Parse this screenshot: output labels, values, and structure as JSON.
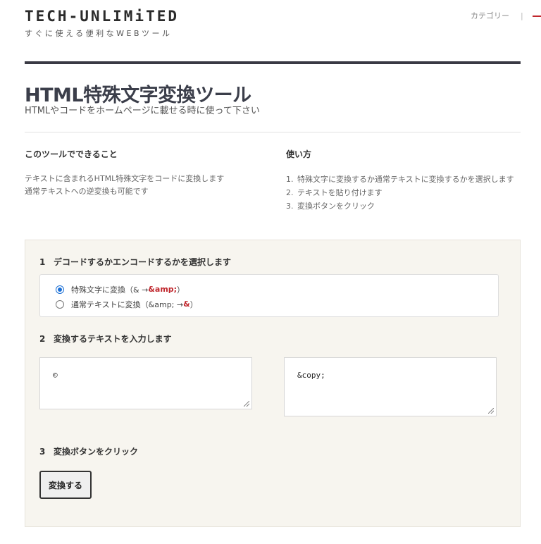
{
  "site": {
    "logo": "TECH-UNLIMiTED",
    "tagline": "すぐに使える便利なWEBツール",
    "nav_categories": "カテゴリー",
    "nav_separator": "|"
  },
  "page": {
    "title": "HTML特殊文字変換ツール",
    "subtitle": "HTMLやコードをホームページに載せる時に使って下さい"
  },
  "about": {
    "heading": "このツールでできること",
    "lines": [
      "テキストに含まれるHTML特殊文字をコードに変換します",
      "通常テキストへの逆変換も可能です"
    ]
  },
  "howto": {
    "heading": "使い方",
    "steps": [
      {
        "num": "1.",
        "text": "特殊文字に変換するか通常テキストに変換するかを選択します"
      },
      {
        "num": "2.",
        "text": "テキストを貼り付けます"
      },
      {
        "num": "3.",
        "text": "変換ボタンをクリック"
      }
    ]
  },
  "tool": {
    "step1": {
      "num": "1",
      "label": "デコードするかエンコードするかを選択します"
    },
    "options": [
      {
        "prefix": "特殊文字に変換（& → ",
        "highlight": "&amp;",
        "suffix": "）",
        "selected": true
      },
      {
        "prefix": "通常テキストに変換（&amp; → ",
        "highlight": "&",
        "suffix": "）",
        "selected": false
      }
    ],
    "step2": {
      "num": "2",
      "label": "変換するテキストを入力します"
    },
    "input_value": "©",
    "output_value": "&copy;",
    "step3": {
      "num": "3",
      "label": "変換ボタンをクリック"
    },
    "convert_button": "変換する"
  },
  "colors": {
    "accent_red": "#c0272d",
    "radio_blue": "#1a6fd6",
    "panel_bg": "#f7f5ef",
    "title_text": "#3b3e4a"
  }
}
